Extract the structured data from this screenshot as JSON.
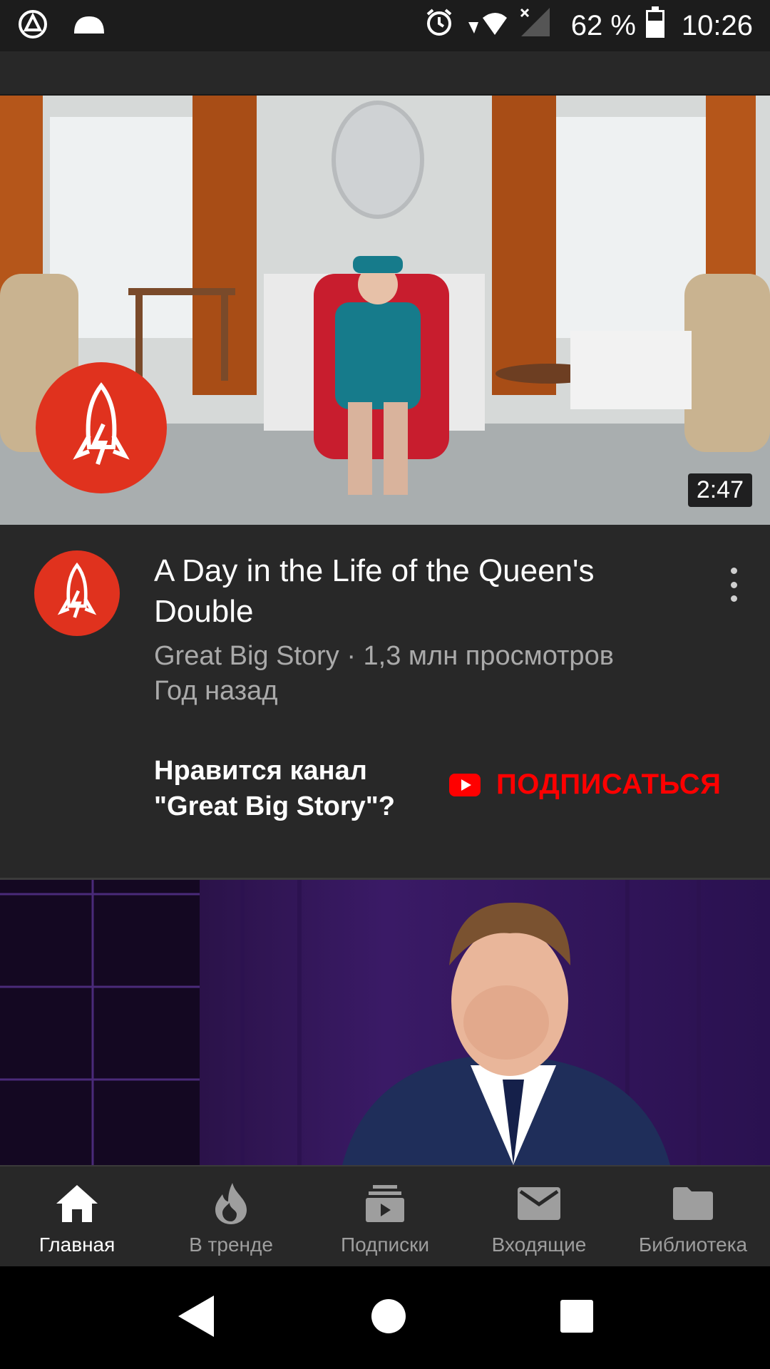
{
  "status_bar": {
    "left_icons": [
      "app-launcher-icon",
      "cloud-icon"
    ],
    "right_icons": [
      "alarm-icon",
      "wifi-icon",
      "signal-icon",
      "battery-icon"
    ],
    "battery": "62 %",
    "time": "10:26"
  },
  "video1": {
    "duration": "2:47",
    "title": "A Day in the Life of the Queen's Double",
    "channel_line": "Great Big Story · 1,3 млн просмотров",
    "age": "Год назад"
  },
  "promo": {
    "text_line1": "Нравится канал",
    "text_line2": "\"Great Big Story\"?",
    "subscribe_label": "ПОДПИСАТЬСЯ"
  },
  "bottom_nav": {
    "items": [
      {
        "label": "Главная",
        "icon": "home-icon",
        "active": true
      },
      {
        "label": "В тренде",
        "icon": "trending-flame-icon",
        "active": false
      },
      {
        "label": "Подписки",
        "icon": "subscriptions-icon",
        "active": false
      },
      {
        "label": "Входящие",
        "icon": "inbox-mail-icon",
        "active": false
      },
      {
        "label": "Библиотека",
        "icon": "library-folder-icon",
        "active": false
      }
    ]
  },
  "colors": {
    "accent_red": "#ff0000",
    "channel_red": "#e0321e",
    "background": "#282828"
  }
}
